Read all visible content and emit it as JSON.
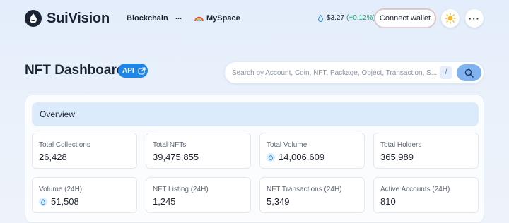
{
  "header": {
    "brand": "SuiVision",
    "nav": {
      "blockchain": "Blockchain",
      "more": "...",
      "myspace": "MySpace"
    },
    "price": {
      "value": "$3.27",
      "change": "(+0.12%)"
    },
    "connect_wallet": "Connect wallet",
    "more_menu": "···"
  },
  "title": {
    "text": "NFT Dashboard",
    "badge": "API"
  },
  "search": {
    "placeholder": "Search by Account, Coin, NFT, Package, Object, Transaction, S...",
    "shortcut": "/"
  },
  "overview": {
    "heading": "Overview",
    "stats": [
      {
        "label": "Total Collections",
        "value": "26,428",
        "sui_icon": false
      },
      {
        "label": "Total NFTs",
        "value": "39,475,855",
        "sui_icon": false
      },
      {
        "label": "Total Volume",
        "value": "14,006,609",
        "sui_icon": true
      },
      {
        "label": "Total Holders",
        "value": "365,989",
        "sui_icon": false
      },
      {
        "label": "Volume (24H)",
        "value": "51,508",
        "sui_icon": true
      },
      {
        "label": "NFT Listing (24H)",
        "value": "1,245",
        "sui_icon": false
      },
      {
        "label": "NFT Transactions (24H)",
        "value": "5,349",
        "sui_icon": false
      },
      {
        "label": "Active Accounts (24H)",
        "value": "810",
        "sui_icon": false
      }
    ]
  },
  "colors": {
    "accent": "#1d86e8",
    "positive": "#22a06b",
    "overview_bg": "#dcebfc"
  }
}
